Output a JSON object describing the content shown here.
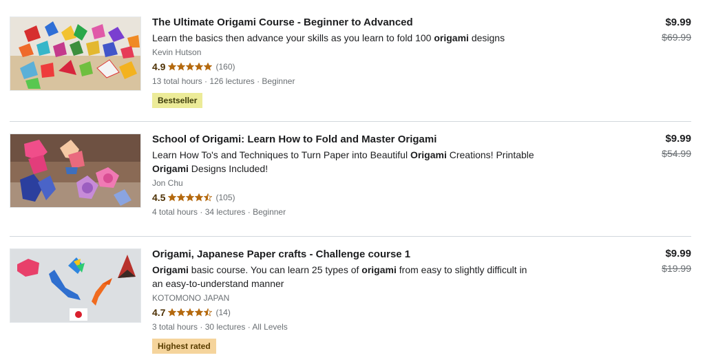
{
  "courses": [
    {
      "title": "The Ultimate Origami Course - Beginner to Advanced",
      "desc": [
        {
          "text": "Learn the basics then advance your skills as you learn to fold 100 ",
          "bold": false
        },
        {
          "text": "origami",
          "bold": true
        },
        {
          "text": " designs",
          "bold": false
        }
      ],
      "author": "Kevin Hutson",
      "rating": "4.9",
      "rating_value": 4.9,
      "count": "(160)",
      "meta": "13 total hours · 126 lectures · Beginner",
      "badge": "Bestseller",
      "badge_type": "bestseller",
      "price": "$9.99",
      "old_price": "$69.99"
    },
    {
      "title": "School of Origami: Learn How to Fold and Master Origami",
      "desc": [
        {
          "text": "Learn How To's and Techniques to Turn Paper into Beautiful ",
          "bold": false
        },
        {
          "text": "Origami",
          "bold": true
        },
        {
          "text": " Creations! Printable ",
          "bold": false
        },
        {
          "text": "Origami",
          "bold": true
        },
        {
          "text": " Designs Included!",
          "bold": false
        }
      ],
      "author": "Jon Chu",
      "rating": "4.5",
      "rating_value": 4.5,
      "count": "(105)",
      "meta": "4 total hours · 34 lectures · Beginner",
      "badge": "",
      "badge_type": "",
      "price": "$9.99",
      "old_price": "$54.99"
    },
    {
      "title": "Origami, Japanese Paper crafts - Challenge course 1",
      "desc": [
        {
          "text": "Origami",
          "bold": true
        },
        {
          "text": " basic course. You can learn 25 types of ",
          "bold": false
        },
        {
          "text": "origami",
          "bold": true
        },
        {
          "text": " from easy to slightly difficult in an easy-to-understand manner",
          "bold": false
        }
      ],
      "author": "KOTOMONO JAPAN",
      "rating": "4.7",
      "rating_value": 4.7,
      "count": "(14)",
      "meta": "3 total hours · 30 lectures · All Levels",
      "badge": "Highest rated",
      "badge_type": "highest",
      "price": "$9.99",
      "old_price": "$19.99"
    }
  ],
  "colors": {
    "star": "#b4690e",
    "rating_text": "#4d3105",
    "bestseller_bg": "#eceb98",
    "highest_bg": "#f5d49c"
  },
  "icons": {
    "star_full": "star-full-icon",
    "star_half": "star-half-icon"
  }
}
